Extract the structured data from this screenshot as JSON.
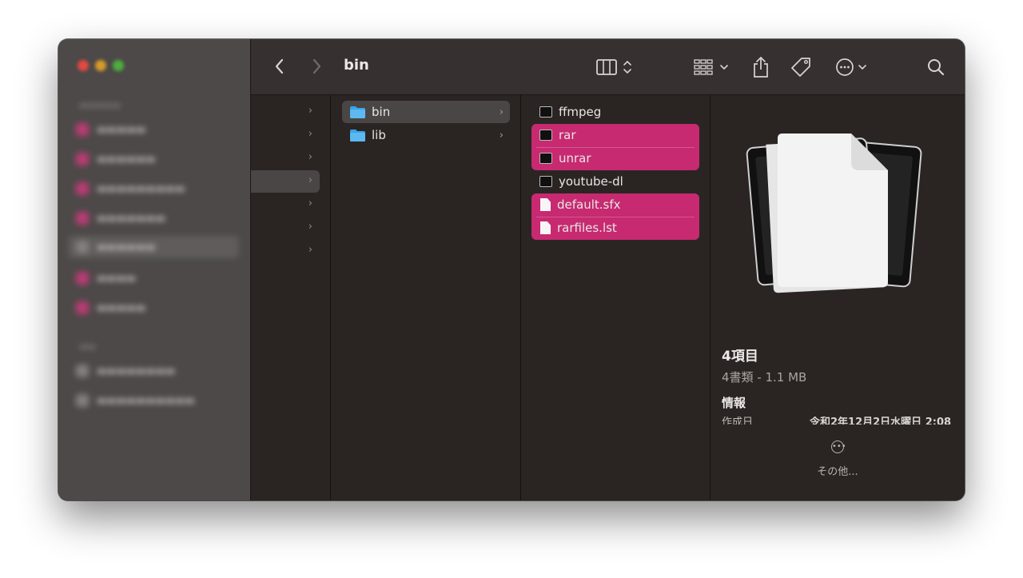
{
  "toolbar": {
    "title": "bin",
    "back_icon": "chevron-left-icon",
    "forward_icon": "chevron-right-icon",
    "view_icon": "column-view-icon",
    "group_icon": "group-grid-icon",
    "share_icon": "share-icon",
    "tag_icon": "tag-icon",
    "action_icon": "ellipsis-circle-icon",
    "search_icon": "search-icon"
  },
  "column2": {
    "items": [
      {
        "label": "bin"
      },
      {
        "label": "lib"
      }
    ]
  },
  "column3": {
    "items": [
      {
        "label": "ffmpeg"
      },
      {
        "label": "rar"
      },
      {
        "label": "unrar"
      },
      {
        "label": "youtube-dl"
      },
      {
        "label": "default.sfx"
      },
      {
        "label": "rarfiles.lst"
      }
    ]
  },
  "preview": {
    "title": "4項目",
    "subtitle": "4書類 - 1.1 MB",
    "info_heading": "情報",
    "created_label": "作成日",
    "created_value": "令和2年12月2日水曜日 2:08",
    "more_label": "その他..."
  },
  "colors": {
    "selection_pink": "#c72a71",
    "window_bg": "#2a2523",
    "toolbar_bg": "#363130"
  }
}
